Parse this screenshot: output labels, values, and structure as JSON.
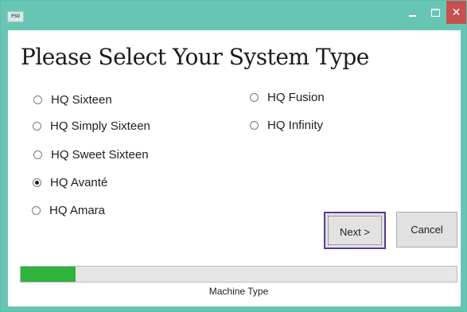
{
  "window": {
    "app_icon_text": "PSU",
    "minimize_icon": "minimize-icon",
    "maximize_icon": "maximize-icon",
    "close_icon": "close-icon",
    "close_glyph": "✕",
    "close_color": "#c75050",
    "titlebar_color": "#67c6b3"
  },
  "heading": "Please Select Your System Type",
  "options": [
    {
      "label": "HQ Sixteen",
      "selected": false
    },
    {
      "label": "HQ Simply Sixteen",
      "selected": false
    },
    {
      "label": "HQ Sweet Sixteen",
      "selected": false
    },
    {
      "label": "HQ Avanté",
      "selected": true
    },
    {
      "label": "HQ Amara",
      "selected": false
    },
    {
      "label": "HQ Fusion",
      "selected": false
    },
    {
      "label": "HQ Infinity",
      "selected": false
    }
  ],
  "buttons": {
    "next_label": "Next >",
    "cancel_label": "Cancel",
    "focus_color": "#5a3a93"
  },
  "progress": {
    "fraction": 0.125,
    "color": "#2fb33d",
    "status_text": "Machine Type"
  }
}
